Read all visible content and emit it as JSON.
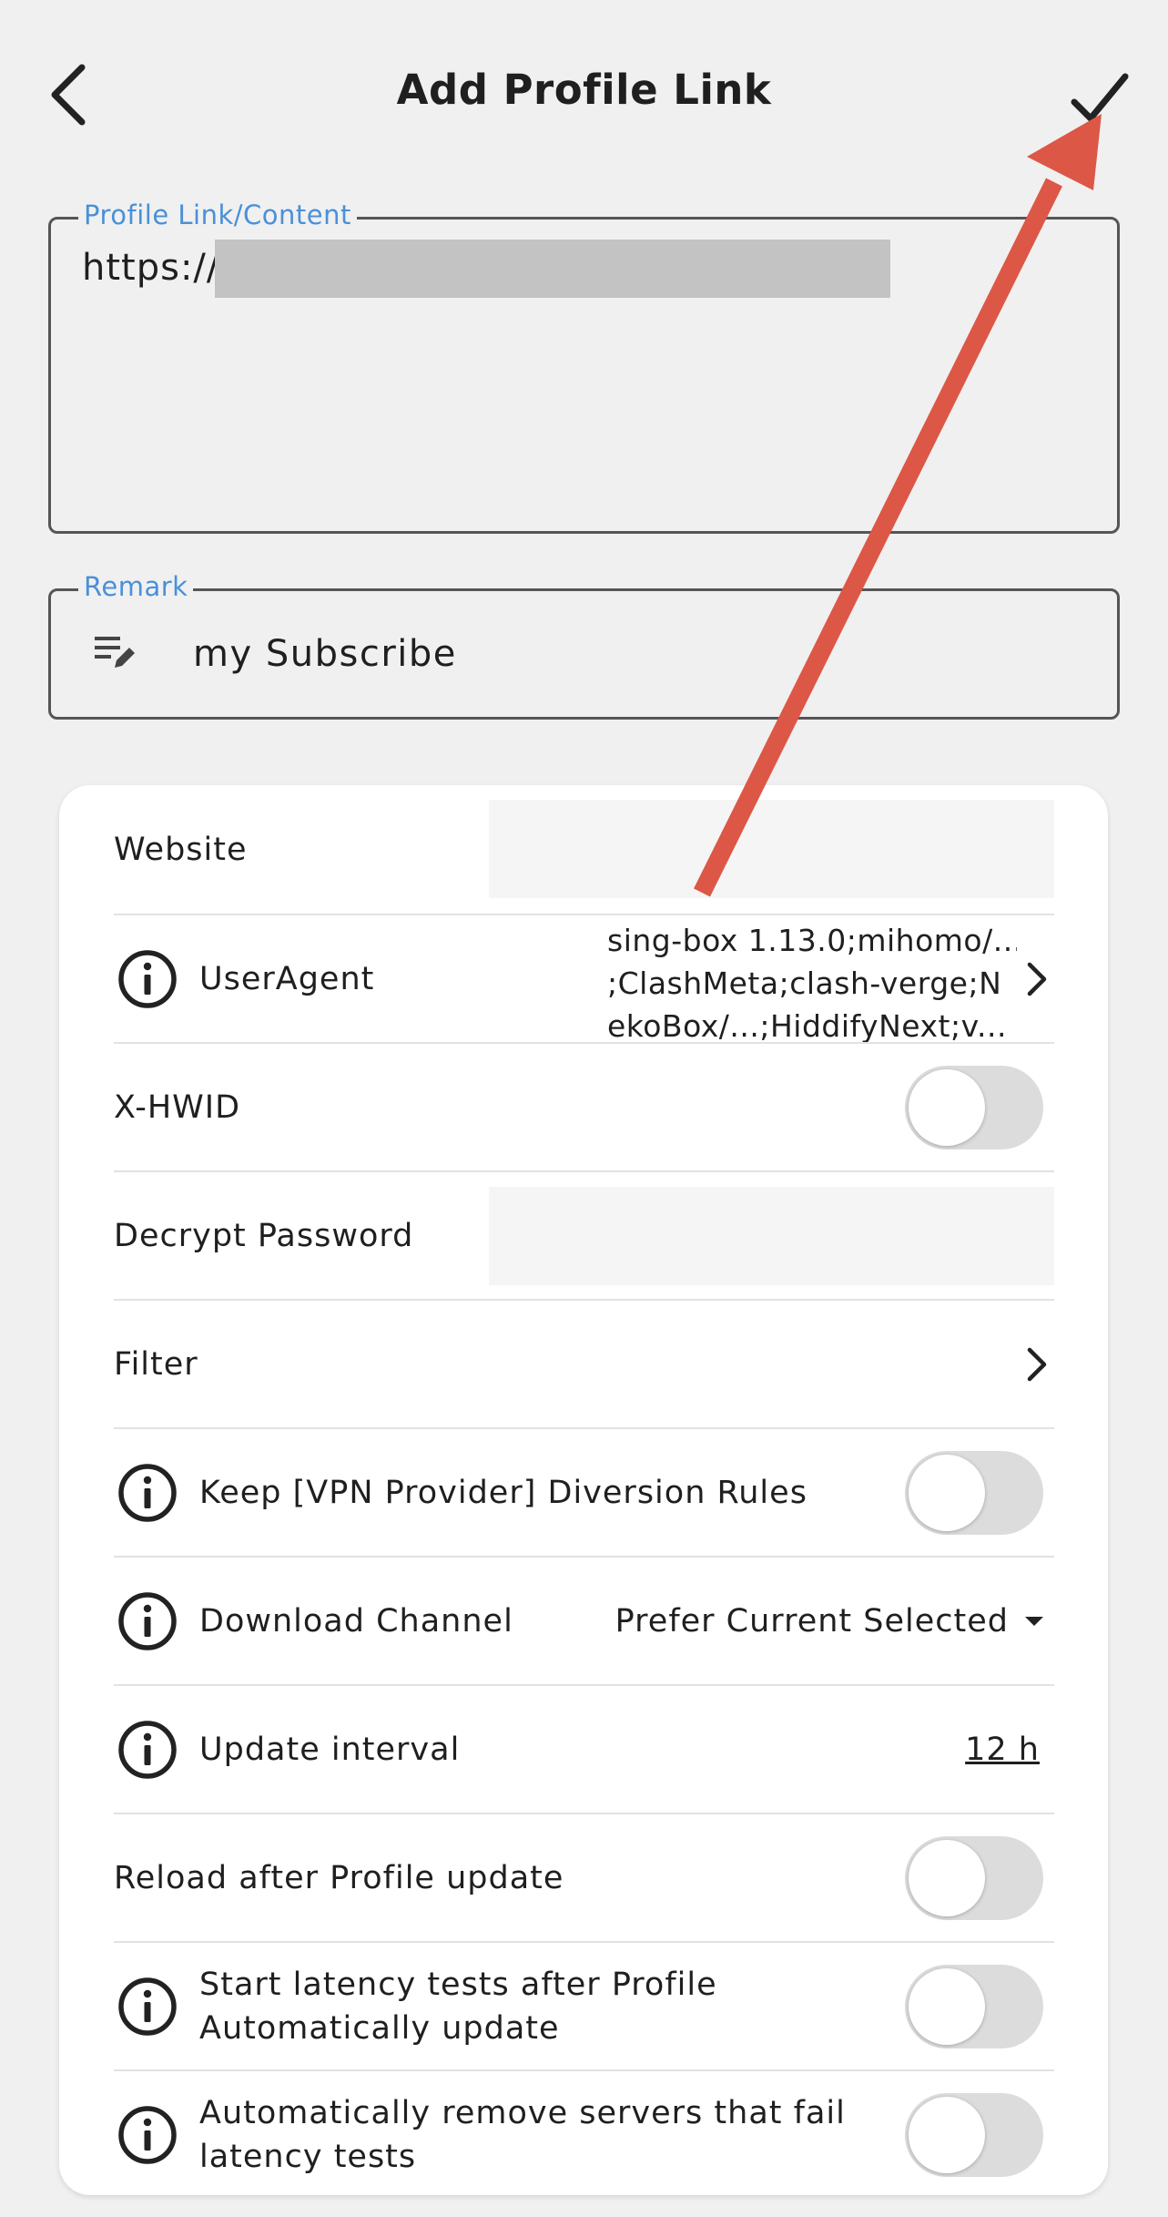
{
  "header": {
    "title": "Add Profile Link",
    "back_icon": "chevron-left-icon",
    "confirm_icon": "check-icon"
  },
  "profile_link": {
    "label": "Profile Link/Content",
    "value": "https://"
  },
  "remark": {
    "label": "Remark",
    "value": "my Subscribe",
    "icon": "edit-note-icon"
  },
  "settings": {
    "website": {
      "label": "Website",
      "value": ""
    },
    "user_agent": {
      "label": "UserAgent",
      "value_lines": [
        "sing-box 1.13.0;mihomo/...",
        ";ClashMeta;clash-verge;N",
        "ekoBox/...;HiddifyNext;v..."
      ]
    },
    "x_hwid": {
      "label": "X-HWID",
      "enabled": false
    },
    "decrypt_password": {
      "label": "Decrypt Password",
      "value": ""
    },
    "filter": {
      "label": "Filter"
    },
    "keep_rules": {
      "label": "Keep [VPN Provider] Diversion Rules",
      "enabled": false
    },
    "download_channel": {
      "label": "Download Channel",
      "value": "Prefer Current Selected"
    },
    "update_interval": {
      "label": "Update interval",
      "value": "12 h"
    },
    "reload_after_update": {
      "label": "Reload after Profile update",
      "enabled": false
    },
    "latency_after_update": {
      "label_lines": [
        "Start latency tests after Profile",
        "Automatically update"
      ],
      "enabled": false
    },
    "remove_failed": {
      "label_lines": [
        "Automatically remove servers that fail",
        "latency tests"
      ],
      "enabled": false
    }
  },
  "colors": {
    "background": "#f0f0f0",
    "accent": "#4a90d9",
    "annotation_arrow": "#dd5746",
    "toggle_off": "#dcdcdc"
  }
}
